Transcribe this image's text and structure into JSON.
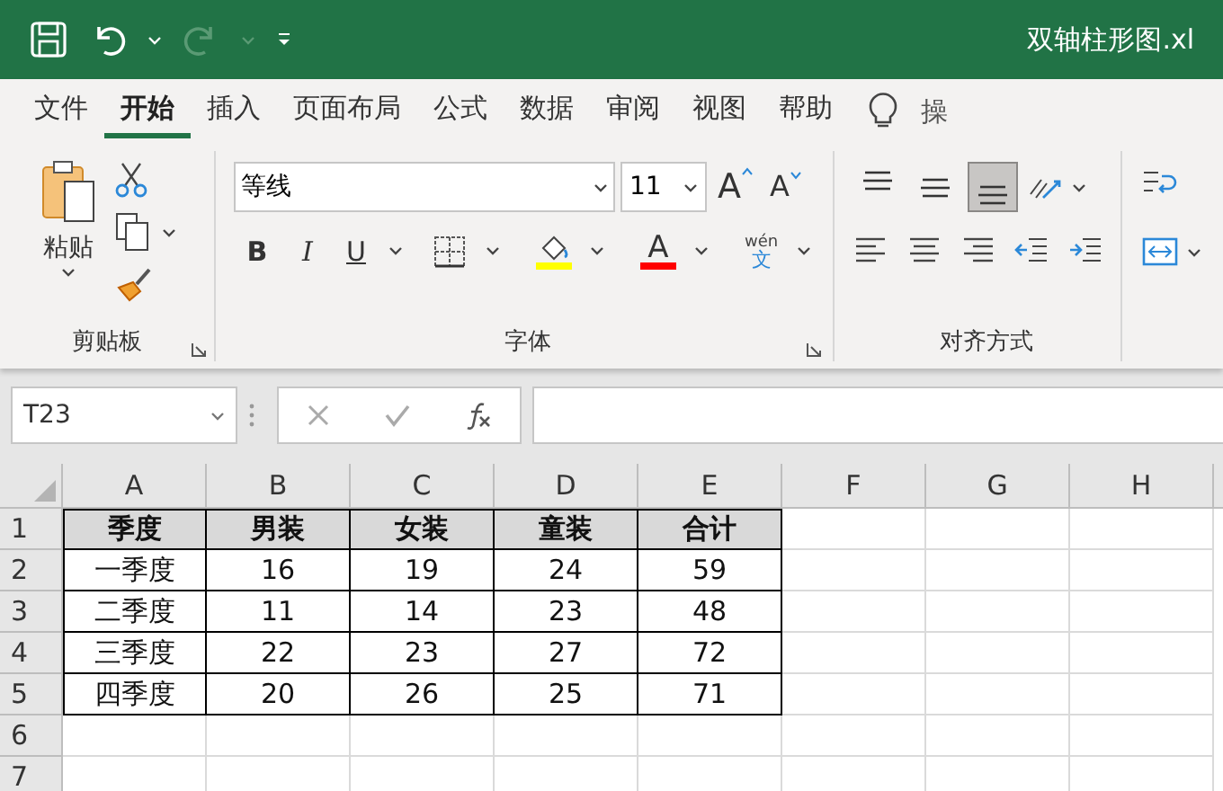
{
  "window": {
    "title": "双轴柱形图.xl"
  },
  "tabs": [
    {
      "label": "文件",
      "selected": false
    },
    {
      "label": "开始",
      "selected": true
    },
    {
      "label": "插入",
      "selected": false
    },
    {
      "label": "页面布局",
      "selected": false
    },
    {
      "label": "公式",
      "selected": false
    },
    {
      "label": "数据",
      "selected": false
    },
    {
      "label": "审阅",
      "selected": false
    },
    {
      "label": "视图",
      "selected": false
    },
    {
      "label": "帮助",
      "selected": false
    }
  ],
  "tell_me": {
    "label": "操"
  },
  "ribbon": {
    "clipboard": {
      "paste": "粘贴",
      "label": "剪贴板"
    },
    "font": {
      "name": "等线",
      "size": "11",
      "grow": "A",
      "shrink": "A",
      "bold": "B",
      "italic": "I",
      "underline": "U",
      "font_color_letter": "A",
      "phonetic": "wén",
      "phonetic_char": "文",
      "label": "字体"
    },
    "alignment": {
      "vertical": [
        {
          "selected": false
        },
        {
          "selected": false
        },
        {
          "selected": true
        }
      ],
      "label": "对齐方式"
    }
  },
  "name_box": {
    "value": "T23"
  },
  "sheet": {
    "columns": [
      "A",
      "B",
      "C",
      "D",
      "E",
      "F",
      "G",
      "H"
    ],
    "row_numbers": [
      "1",
      "2",
      "3",
      "4",
      "5",
      "6",
      "7"
    ],
    "header_row": [
      "季度",
      "男装",
      "女装",
      "童装",
      "合计"
    ],
    "rows": [
      [
        "一季度",
        "16",
        "19",
        "24",
        "59"
      ],
      [
        "二季度",
        "11",
        "14",
        "23",
        "48"
      ],
      [
        "三季度",
        "22",
        "23",
        "27",
        "72"
      ],
      [
        "四季度",
        "20",
        "26",
        "25",
        "71"
      ]
    ]
  }
}
